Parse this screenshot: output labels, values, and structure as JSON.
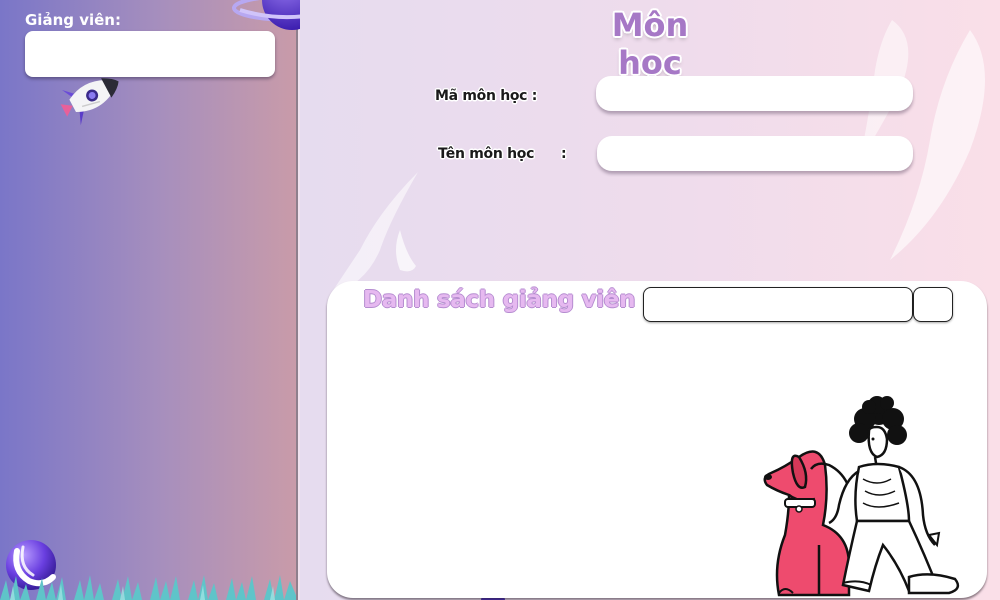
{
  "sidebar": {
    "lecturer_label": "Giảng viên:",
    "lecturer_value": ""
  },
  "form": {
    "title": "Môn học",
    "code_label": "Mã môn học :",
    "code_value": "",
    "name_label": "Tên môn học",
    "name_colon": ":",
    "name_value": ""
  },
  "panel": {
    "title": "Danh sách giảng viên",
    "search_value": "",
    "button_label": ""
  },
  "decorations": {
    "icons": [
      "planet-icon",
      "rocket-icon",
      "ball-planet-icon",
      "grass-icon",
      "feather-icon",
      "woman-with-dog-illustration"
    ]
  },
  "colors": {
    "sidebar_left": "#7a76c8",
    "sidebar_right": "#c99ba9",
    "title": "#a678c6",
    "panel_title": "#e6b9f0",
    "dog": "#ee4b6e"
  }
}
